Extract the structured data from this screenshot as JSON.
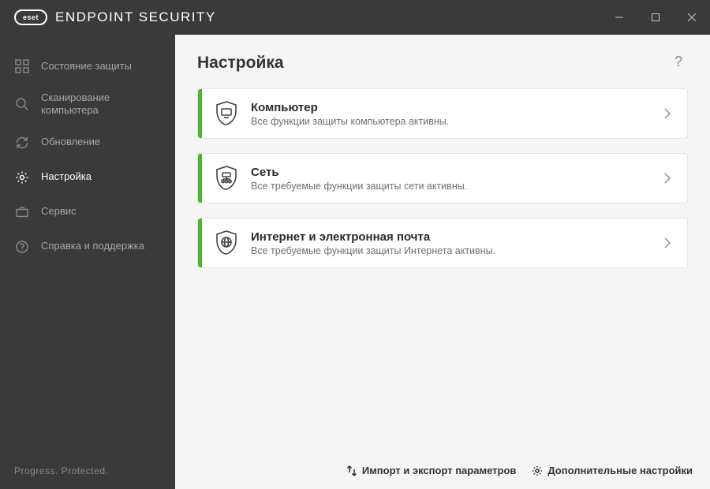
{
  "app": {
    "brand": "eset",
    "title": "ENDPOINT SECURITY"
  },
  "sidebar": {
    "items": [
      {
        "label": "Состояние защиты"
      },
      {
        "label": "Сканирование компьютера"
      },
      {
        "label": "Обновление"
      },
      {
        "label": "Настройка"
      },
      {
        "label": "Сервис"
      },
      {
        "label": "Справка и поддержка"
      }
    ],
    "tagline": "Progress. Protected."
  },
  "main": {
    "title": "Настройка",
    "help": "?",
    "cards": [
      {
        "title": "Компьютер",
        "subtitle": "Все функции защиты компьютера активны.",
        "status_color": "#4db430"
      },
      {
        "title": "Сеть",
        "subtitle": "Все требуемые функции защиты сети активны.",
        "status_color": "#4db430"
      },
      {
        "title": "Интернет и электронная почта",
        "subtitle": "Все требуемые функции защиты Интернета активны.",
        "status_color": "#4db430"
      }
    ],
    "footer": {
      "import_export": "Импорт и экспорт параметров",
      "advanced": "Дополнительные настройки"
    }
  }
}
